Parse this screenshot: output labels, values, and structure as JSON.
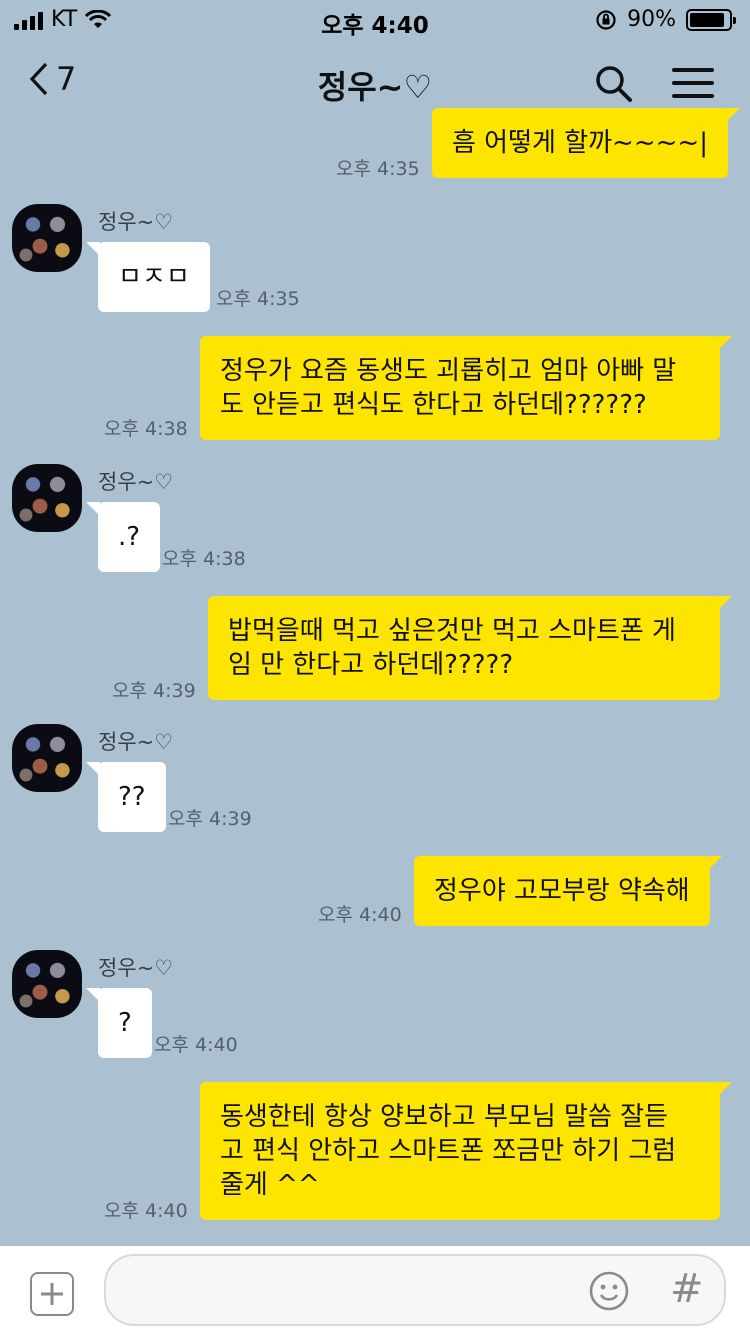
{
  "status_bar": {
    "carrier": "KT",
    "time": "오후 4:40",
    "battery": "90%",
    "battery_level": 0.9
  },
  "header": {
    "back_count": "7",
    "title": "정우~♡"
  },
  "messages": [
    {
      "side": "mine",
      "text": "흠 어떻게 할까~~~~|",
      "time": "오후 4:35"
    },
    {
      "side": "theirs",
      "sender": "정우~♡",
      "text": "ㅁㅈㅁ",
      "time": "오후 4:35"
    },
    {
      "side": "mine",
      "line1": "정우가 요즘 동생도 괴롭히고 엄마 아빠 말",
      "line2": "도 안듣고 편식도 한다고 하던데??????",
      "time": "오후 4:38"
    },
    {
      "side": "theirs",
      "sender": "정우~♡",
      "text": ".?",
      "time": "오후 4:38"
    },
    {
      "side": "mine",
      "line1": "밥먹을때 먹고 싶은것만 먹고 스마트폰 게",
      "line2": "임 만 한다고 하던데?????",
      "time": "오후 4:39"
    },
    {
      "side": "theirs",
      "sender": "정우~♡",
      "text": "??",
      "time": "오후 4:39"
    },
    {
      "side": "mine",
      "text": "정우야 고모부랑 약속해",
      "time": "오후 4:40"
    },
    {
      "side": "theirs",
      "sender": "정우~♡",
      "text": "?",
      "time": "오후 4:40"
    },
    {
      "side": "mine",
      "line1": "동생한테 항상 양보하고 부모님 말씀 잘듣",
      "line2": "고 편식 안하고 스마트폰 쪼금만 하기 그럼",
      "line3": "줄게 ^^",
      "time": "오후 4:40"
    }
  ],
  "footer": {
    "input_value": ""
  },
  "colors": {
    "background": "#abc1d1",
    "my_bubble": "#fee500",
    "their_bubble": "#ffffff"
  }
}
